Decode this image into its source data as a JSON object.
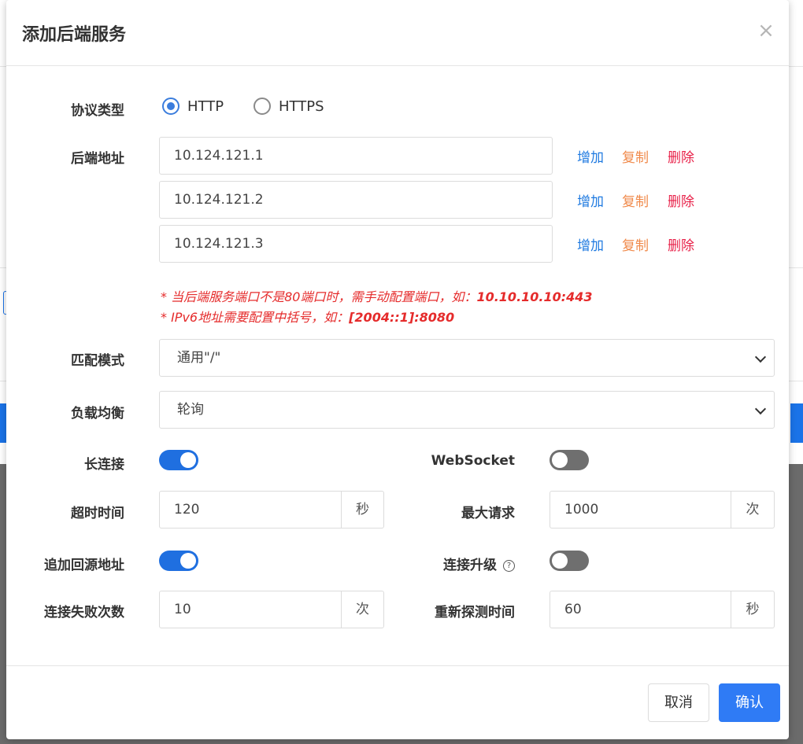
{
  "modal": {
    "title": "添加后端服务",
    "close_glyph": "×"
  },
  "protocol": {
    "label": "协议类型",
    "options": [
      "HTTP",
      "HTTPS"
    ],
    "selected": "HTTP"
  },
  "backend": {
    "label": "后端地址",
    "addresses": [
      "10.124.121.1",
      "10.124.121.2",
      "10.124.121.3"
    ],
    "actions": {
      "add": "增加",
      "copy": "复制",
      "delete": "删除"
    },
    "hint1_prefix": "* 当后端服务端口不是80端口时，需手动配置端口，如：",
    "hint1_example": "10.10.10.10:443",
    "hint2_prefix": "* IPv6地址需要配置中括号，如：",
    "hint2_example": "[2004::1]:8080"
  },
  "match_mode": {
    "label": "匹配模式",
    "value": "通用\"/\""
  },
  "load_balance": {
    "label": "负载均衡",
    "value": "轮询"
  },
  "keepalive": {
    "label": "长连接",
    "enabled": true
  },
  "websocket": {
    "label": "WebSocket",
    "enabled": false
  },
  "timeout": {
    "label": "超时时间",
    "value": "120",
    "unit": "秒"
  },
  "max_requests": {
    "label": "最大请求",
    "value": "1000",
    "unit": "次"
  },
  "append_origin": {
    "label": "追加回源地址",
    "enabled": true
  },
  "conn_upgrade": {
    "label": "连接升级",
    "help_glyph": "?",
    "enabled": false
  },
  "fail_count": {
    "label": "连接失败次数",
    "value": "10",
    "unit": "次"
  },
  "reprobe": {
    "label": "重新探测时间",
    "value": "60",
    "unit": "秒"
  },
  "footer": {
    "cancel": "取消",
    "confirm": "确认"
  },
  "colors": {
    "primary": "#2f7bf5",
    "add": "#1f7ae0",
    "copy": "#f08a4b",
    "delete": "#e8224a",
    "hint": "#e52b2b"
  }
}
